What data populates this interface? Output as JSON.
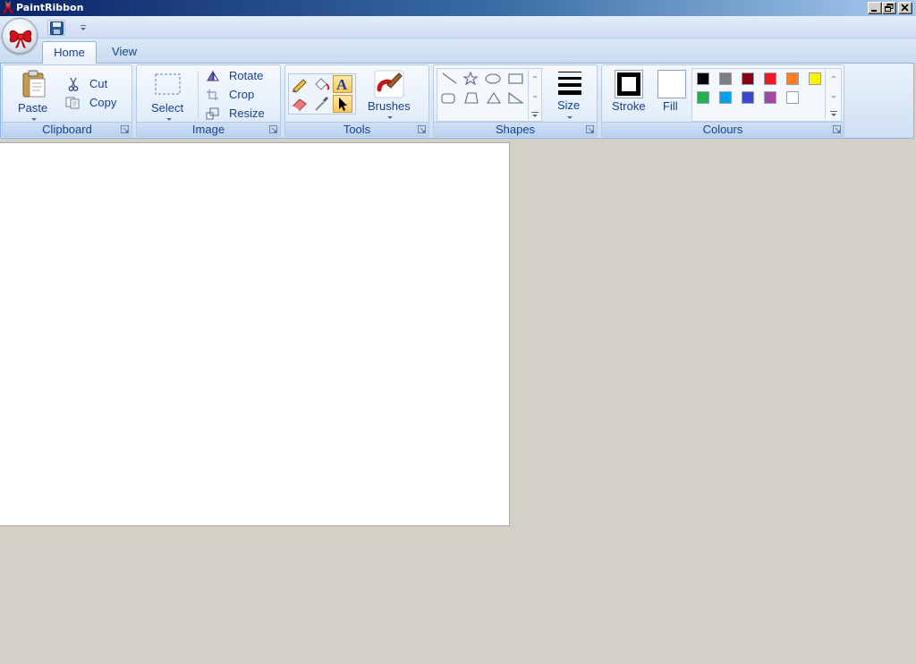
{
  "window": {
    "title": "PaintRibbon"
  },
  "tabs": [
    {
      "label": "Home"
    },
    {
      "label": "View"
    }
  ],
  "clipboard": {
    "label": "Clipboard",
    "paste": "Paste",
    "cut": "Cut",
    "copy": "Copy"
  },
  "image": {
    "label": "Image",
    "select": "Select",
    "rotate": "Rotate",
    "crop": "Crop",
    "resize": "Resize"
  },
  "tools": {
    "label": "Tools",
    "brushes": "Brushes"
  },
  "shapes": {
    "label": "Shapes",
    "size": "Size"
  },
  "colours": {
    "label": "Colours",
    "stroke": "Stroke",
    "fill": "Fill",
    "stroke_color": "#000000",
    "fill_color": "#ffffff",
    "palette": [
      "#000000",
      "#7f7f7f",
      "#880015",
      "#ed1c24",
      "#ff7f27",
      "#fff200",
      "#22b14c",
      "#00a2e8",
      "#3f48cc",
      "#a349a4",
      "#ffffff"
    ]
  }
}
